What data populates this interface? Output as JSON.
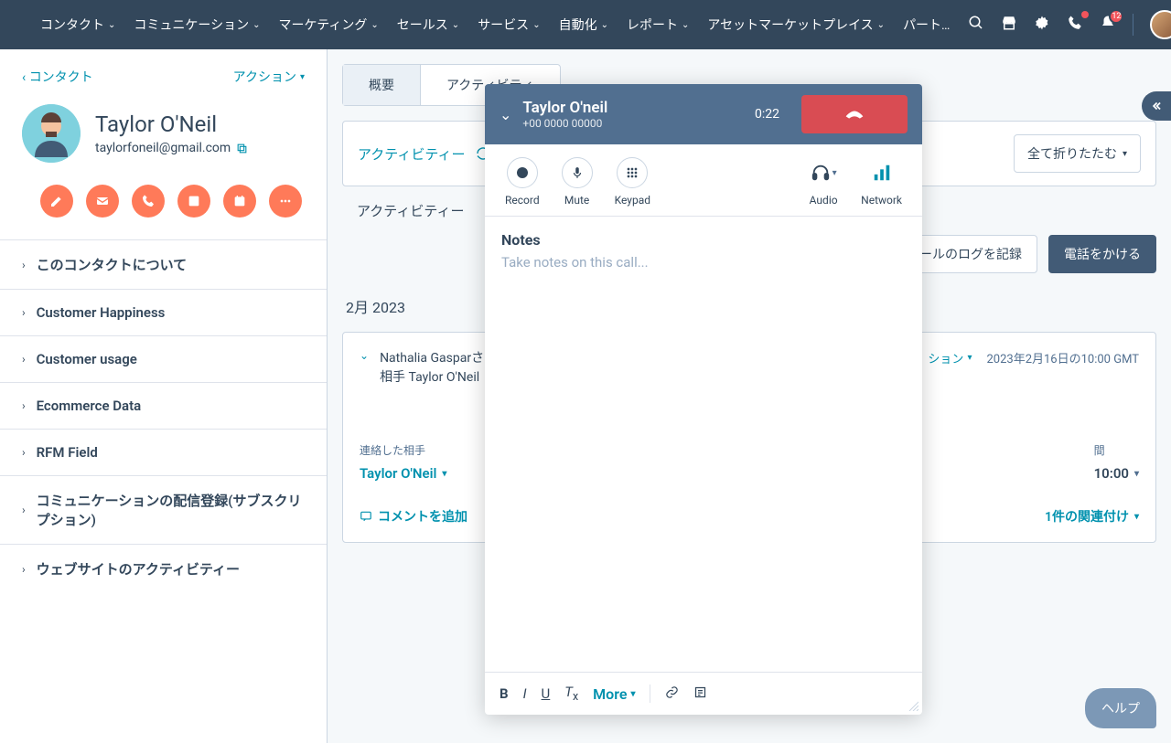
{
  "nav": {
    "items": [
      "コンタクト",
      "コミュニケーション",
      "マーケティング",
      "セールス",
      "サービス",
      "自動化",
      "レポート",
      "アセットマーケットプレイス",
      "パート…"
    ],
    "badge_count": "12"
  },
  "sidebar": {
    "back": "コンタクト",
    "action": "アクション",
    "name": "Taylor O'Neil",
    "email": "taylorfoneil@gmail.com",
    "sections": [
      "このコンタクトについて",
      "Customer Happiness",
      "Customer usage",
      "Ecommerce Data",
      "RFM Field",
      "コミュニケーションの配信登録(サブスクリプション)",
      "ウェブサイトのアクティビティー"
    ]
  },
  "main": {
    "tabs": [
      "概要",
      "アクティビティ"
    ],
    "filter_label": "アクティビティー",
    "collapse_all": "全て折りたたむ",
    "sub_tab": "アクティビティー",
    "log_email": "Eメールのログを記録",
    "make_call": "電話をかける",
    "month": "2月 2023"
  },
  "activity": {
    "title_line1": "Nathalia Gasparさ",
    "title_line2": "相手 Taylor O'Neil",
    "action_label": "ション",
    "timestamp": "2023年2月16日の10:00 GMT",
    "contacted_label": "連絡した相手",
    "contacted_value": "Taylor O'Neil",
    "time_label": "間",
    "time_value": "10:00",
    "add_comment": "コメントを追加",
    "associations": "1件の関連付け"
  },
  "call": {
    "name": "Taylor O'neil",
    "phone": "+00 0000 00000",
    "timer": "0:22",
    "controls": {
      "record": "Record",
      "mute": "Mute",
      "keypad": "Keypad",
      "audio": "Audio",
      "network": "Network"
    },
    "notes_title": "Notes",
    "notes_placeholder": "Take notes on this call...",
    "more": "More"
  },
  "help": "ヘルプ"
}
